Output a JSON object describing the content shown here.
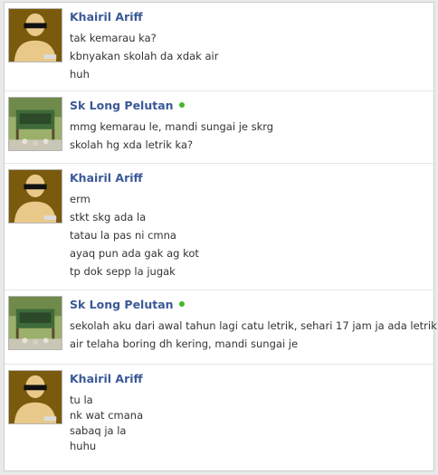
{
  "conversation": {
    "blocks": [
      {
        "sender": "Khairil Ariff",
        "avatar": "silhouette-avatar",
        "online": false,
        "messages": [
          "tak kemarau ka?",
          "kbnyakan skolah da xdak air",
          "huh"
        ]
      },
      {
        "sender": "Sk Long Pelutan",
        "avatar": "school-photo-avatar",
        "online": true,
        "messages": [
          "mmg kemarau le, mandi sungai je skrg",
          "skolah hg xda letrik ka?"
        ]
      },
      {
        "sender": "Khairil Ariff",
        "avatar": "silhouette-avatar",
        "online": false,
        "messages": [
          "erm",
          "stkt skg ada la",
          "tatau la pas ni cmna",
          "ayaq pun ada gak ag kot",
          "tp dok sepp la jugak"
        ]
      },
      {
        "sender": "Sk Long Pelutan",
        "avatar": "school-photo-avatar",
        "online": true,
        "messages": [
          "sekolah aku dari awal tahun lagi catu letrik, sehari 17 jam ja ada letrik",
          "air telaha boring dh kering, mandi sungai je"
        ]
      },
      {
        "sender": "Khairil Ariff",
        "avatar": "silhouette-avatar",
        "online": false,
        "messages": [
          "tu la",
          "nk wat cmana",
          "sabaq ja la",
          "huhu"
        ]
      }
    ]
  },
  "colors": {
    "name_link": "#3b5998",
    "message_text": "#333333",
    "online_indicator": "#42b72a",
    "divider": "#e3e6ee",
    "avatar_silhouette_bg": "#7a5a0c"
  }
}
